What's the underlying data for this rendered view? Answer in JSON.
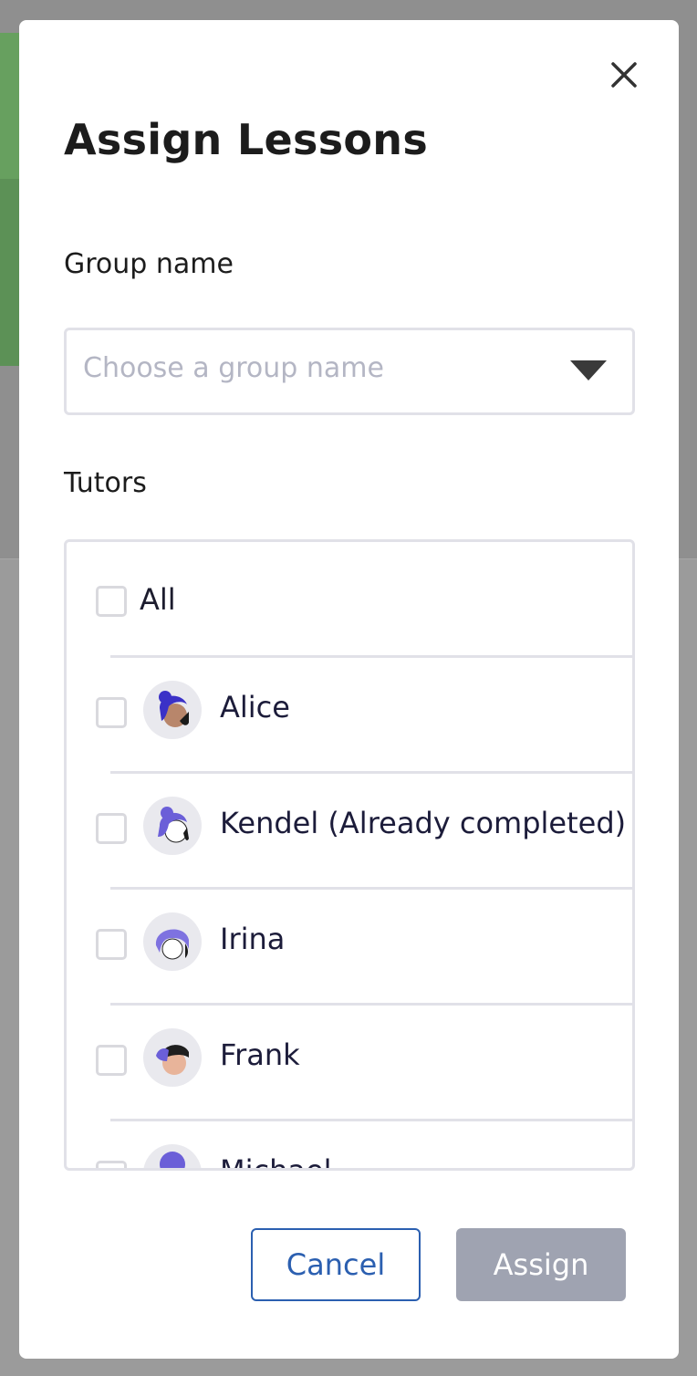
{
  "modal": {
    "title": "Assign Lessons",
    "close_icon": "close-icon"
  },
  "group": {
    "label": "Group name",
    "placeholder": "Choose a group name",
    "dropdown_icon": "caret-down-icon"
  },
  "tutors": {
    "label": "Tutors",
    "all_label": "All",
    "items": [
      {
        "name": "Alice"
      },
      {
        "name": "Kendel (Already completed)"
      },
      {
        "name": "Irina"
      },
      {
        "name": "Frank"
      },
      {
        "name": "Michael"
      }
    ]
  },
  "actions": {
    "cancel_label": "Cancel",
    "assign_label": "Assign"
  },
  "colors": {
    "accent": "#2b5fb0",
    "disabled_button": "#9fa3b1",
    "border": "#e1e1e8"
  }
}
